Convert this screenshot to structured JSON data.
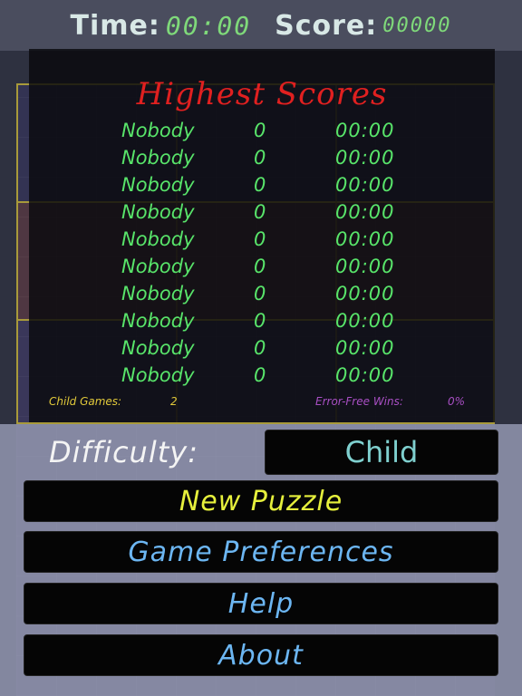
{
  "header": {
    "time_label": "Time:",
    "time_value": "00:00",
    "score_label": "Score:",
    "score_value": "00000"
  },
  "high_scores": {
    "title": "Highest Scores",
    "rows": [
      {
        "name": "Nobody",
        "score": "0",
        "time": "00:00"
      },
      {
        "name": "Nobody",
        "score": "0",
        "time": "00:00"
      },
      {
        "name": "Nobody",
        "score": "0",
        "time": "00:00"
      },
      {
        "name": "Nobody",
        "score": "0",
        "time": "00:00"
      },
      {
        "name": "Nobody",
        "score": "0",
        "time": "00:00"
      },
      {
        "name": "Nobody",
        "score": "0",
        "time": "00:00"
      },
      {
        "name": "Nobody",
        "score": "0",
        "time": "00:00"
      },
      {
        "name": "Nobody",
        "score": "0",
        "time": "00:00"
      },
      {
        "name": "Nobody",
        "score": "0",
        "time": "00:00"
      },
      {
        "name": "Nobody",
        "score": "0",
        "time": "00:00"
      }
    ],
    "games_label": "Child Games:",
    "games_value": "2",
    "wins_label": "Error-Free Wins:",
    "wins_value": "0%"
  },
  "menu": {
    "difficulty_label": "Difficulty:",
    "difficulty_value": "Child",
    "new_puzzle": "New Puzzle",
    "preferences": "Game Preferences",
    "help": "Help",
    "about": "About"
  },
  "colors": {
    "time_value": "#7fd97a",
    "title": "#e02020",
    "rows": "#58e46a",
    "new_puzzle": "#e6f03c",
    "menu_text": "#6cb6f2",
    "difficulty_value": "#7fd0cf"
  }
}
